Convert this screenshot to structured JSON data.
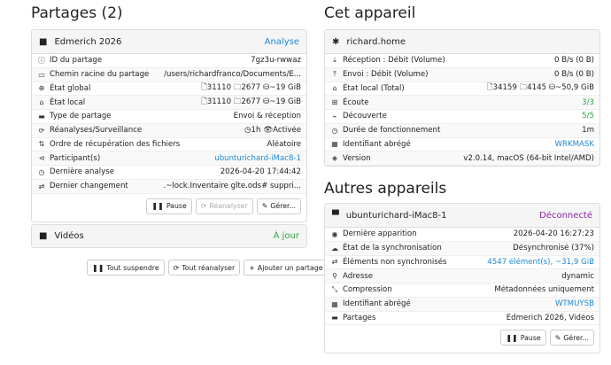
{
  "left": {
    "title": "Partages (2)",
    "share1": {
      "name": "Edmerich 2026",
      "status": "Analyse",
      "rows": [
        {
          "label": "ID du partage",
          "value": "7gz3u-rwwaz"
        },
        {
          "label": "Chemin racine du partage",
          "value": "/users/richardfranco/Documents/E..."
        },
        {
          "label": "État global",
          "value": "🗋31110  🗀2677  ⛁~19 GiB"
        },
        {
          "label": "État local",
          "value": "🗋31110  🗀2677  ⛁~19 GiB"
        },
        {
          "label": "Type de partage",
          "value": "Envoi & réception"
        },
        {
          "label": "Réanalyses/Surveillance",
          "value": "◷1h  👁Activée"
        },
        {
          "label": "Ordre de récupération des fichiers",
          "value": "Aléatoire"
        },
        {
          "label": "Participant(s)",
          "value": "ubunturichard-iMac8-1"
        },
        {
          "label": "Dernière analyse",
          "value": "2026-04-20 17:44:42"
        },
        {
          "label": "Dernier changement",
          "value": ".~lock.Inventaire gîte.ods# suppri..."
        }
      ],
      "buttons": {
        "pause": "Pause",
        "rescan": "Réanalyser",
        "edit": "Gérer..."
      }
    },
    "share2": {
      "name": "Vidéos",
      "status": "À jour"
    },
    "actions": {
      "pause_all": "Tout suspendre",
      "rescan_all": "Tout réanalyser",
      "add": "Ajouter un partage"
    }
  },
  "right": {
    "this_title": "Cet appareil",
    "this": {
      "name": "richard.home",
      "rows": [
        {
          "label": "Réception : Débit (Volume)",
          "value": "0 B/s (0 B)"
        },
        {
          "label": "Envoi : Débit (Volume)",
          "value": "0 B/s (0 B)"
        },
        {
          "label": "État local (Total)",
          "value": "🗋34159  🗀4145  ⛁~50,9 GiB"
        },
        {
          "label": "Écoute",
          "value": "3/3"
        },
        {
          "label": "Découverte",
          "value": "5/5"
        },
        {
          "label": "Durée de fonctionnement",
          "value": "1m"
        },
        {
          "label": "Identifiant abrégé",
          "value": "WRKMASK"
        },
        {
          "label": "Version",
          "value": "v2.0.14, macOS (64-bit Intel/AMD)"
        }
      ]
    },
    "others_title": "Autres appareils",
    "other": {
      "name": "ubunturichard-iMac8-1",
      "status": "Déconnecté",
      "rows": [
        {
          "label": "Dernière apparition",
          "value": "2026-04-20 16:27:23"
        },
        {
          "label": "État de la synchronisation",
          "value": "Désynchronisé (37%)"
        },
        {
          "label": "Éléments non synchronisés",
          "value": "4547 élément(s), ~31,9 GiB"
        },
        {
          "label": "Adresse",
          "value": "dynamic"
        },
        {
          "label": "Compression",
          "value": "Métadonnées uniquement"
        },
        {
          "label": "Identifiant abrégé",
          "value": "WTMUYSB"
        },
        {
          "label": "Partages",
          "value": "Edmerich 2026, Vidéos"
        }
      ],
      "buttons": {
        "pause": "Pause",
        "edit": "Gérer..."
      }
    }
  },
  "colors": {
    "blue": "#1e88d4",
    "green": "#29a745",
    "purple": "#8e24aa"
  }
}
